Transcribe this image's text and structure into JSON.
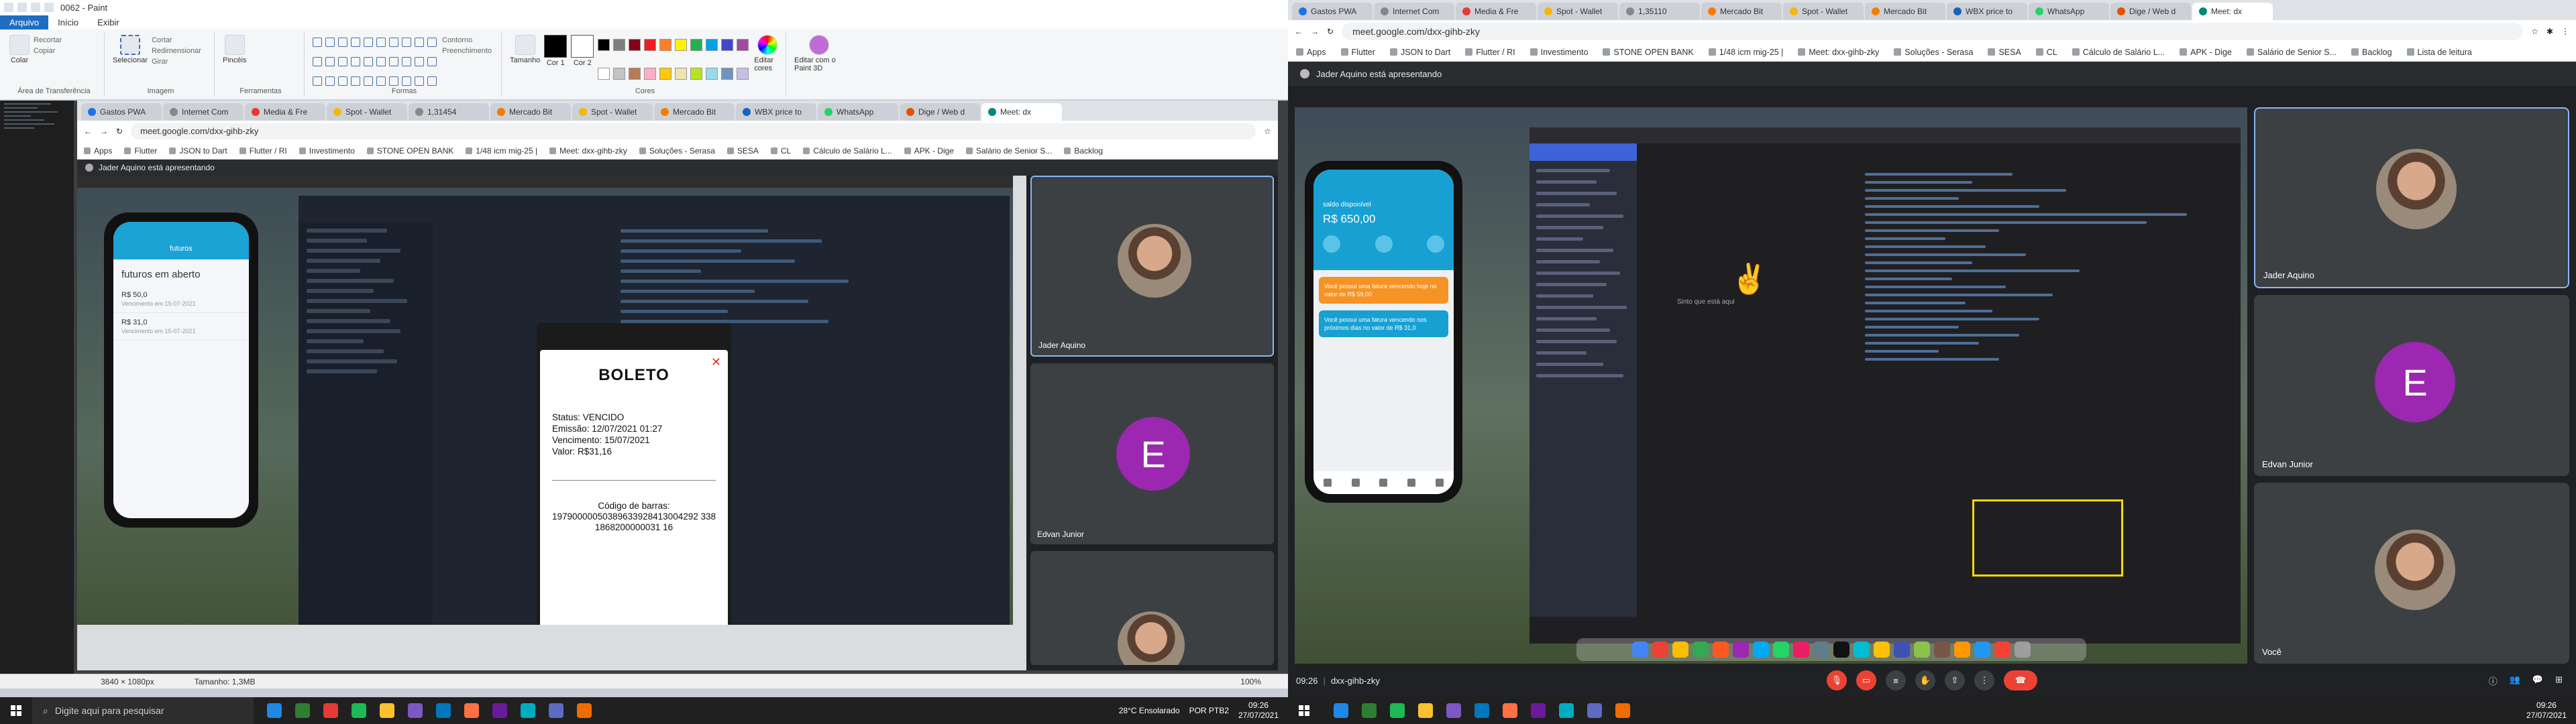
{
  "paint": {
    "title": "0062 - Paint",
    "menu": [
      "Arquivo",
      "Início",
      "Exibir"
    ],
    "groups": {
      "clipboard": {
        "label": "Área de Transferência",
        "paste": "Colar",
        "cut": "Recortar",
        "copy": "Copiar"
      },
      "image": {
        "label": "Imagem",
        "select": "Selecionar",
        "crop": "Cortar",
        "resize": "Redimensionar",
        "rotate": "Girar"
      },
      "tools": {
        "label": "Ferramentas",
        "brushes": "Pincéis"
      },
      "shapes": {
        "label": "Formas",
        "outline": "Contorno",
        "fill": "Preenchimento"
      },
      "colors": {
        "label": "Cores",
        "size": "Tamanho",
        "color1": "Cor 1",
        "color2": "Cor 2",
        "edit": "Editar cores",
        "paint3d": "Editar com o Paint 3D"
      }
    },
    "status": {
      "dimensions": "3840 × 1080px",
      "size": "Tamanho: 1,3MB",
      "zoom": "100%"
    }
  },
  "palette": [
    "#000000",
    "#7f7f7f",
    "#880015",
    "#ed1c24",
    "#ff7f27",
    "#fff200",
    "#22b14c",
    "#00a2e8",
    "#3f48cc",
    "#a349a4",
    "#ffffff",
    "#c3c3c3",
    "#b97a57",
    "#ffaec9",
    "#ffc90e",
    "#efe4b0",
    "#b5e61d",
    "#99d9ea",
    "#7092be",
    "#c8bfe7"
  ],
  "left_browser": {
    "tabs": [
      "Gastos PWA",
      "Internet Com",
      "Media & Fre",
      "Spot - Wallet",
      "1,31454 ",
      "Mercado Bit",
      "Spot - Wallet",
      "Mercado Bit",
      "WBX price to",
      "WhatsApp",
      "Dige / Web d",
      "Meet: dx"
    ],
    "url": "meet.google.com/dxx-gihb-zky",
    "bookmarks": [
      "Apps",
      "Flutter",
      "JSON to Dart",
      "Flutter / RI",
      "Investimento",
      "STONE OPEN BANK",
      "1/48 icm mig-25 |",
      "Meet: dxx-gihb-zky",
      "Soluções - Serasa",
      "SESA",
      "CL",
      "Cálculo de Salário L...",
      "APK - Dige",
      "Salário de Senior S...",
      "Backlog"
    ],
    "presenting": "Jader Aquino está apresentando",
    "phone": {
      "header": "futuros",
      "title": "futuros em aberto",
      "items": [
        {
          "value": "R$ 50,0",
          "sub": "Vencimento em 15-07-2021"
        },
        {
          "value": "R$ 31,0",
          "sub": "Vencimento em 15-07-2021"
        }
      ]
    },
    "boleto": {
      "title": "BOLETO",
      "status": "Status: VENCIDO",
      "emissao": "Emissão: 12/07/2021   01:27",
      "vencimento": "Vencimento: 15/07/2021",
      "valor": "Valor: R$31,16",
      "barcode_label": "Código de barras:",
      "barcode": "19790000050389633928413004292 3381868200000031 16"
    },
    "participants": [
      "Jader Aquino",
      "Edvan Junior"
    ],
    "participant_letter": "E"
  },
  "left_taskbar": {
    "search": "Digite aqui para pesquisar",
    "weather": "28°C  Ensolarado",
    "lang": "POR PTB2",
    "time": "09:26",
    "date": "27/07/2021"
  },
  "right_browser": {
    "tabs": [
      "Gastos PWA",
      "Internet Com",
      "Media & Fre",
      "Spot - Wallet",
      "1,35110 ",
      "Mercado Bit",
      "Spot - Wallet",
      "Mercado Bit",
      "WBX price to",
      "WhatsApp",
      "Dige / Web d",
      "Meet: dx"
    ],
    "url": "meet.google.com/dxx-gihb-zky",
    "bookmarks": [
      "Apps",
      "Flutter",
      "JSON to Dart",
      "Flutter / RI",
      "Investimento",
      "STONE OPEN BANK",
      "1/48 icm mig-25 |",
      "Meet: dxx-gihb-zky",
      "Soluções - Serasa",
      "SESA",
      "CL",
      "Cálculo de Salário L...",
      "APK - Dige",
      "Salário de Senior S...",
      "Backlog",
      "Lista de leitura"
    ],
    "presenting": "Jader Aquino está apresentando",
    "phone": {
      "balance_label": "saldo disponível",
      "balance": "R$ 650,00",
      "alert1": "Você possui uma fatura vencendo hoje no valor de R$ 59,00",
      "alert2": "Você possui uma fatura vencendo nos próximos dias no valor de R$ 31,0"
    },
    "raise_text": "Sinto que está aqui",
    "participants": [
      "Jader Aquino",
      "Edvan Junior",
      "Você"
    ],
    "participant_letter": "E",
    "meeting": {
      "time": "09:26",
      "separator": "|",
      "code": "dxx-gihb-zky"
    },
    "taskbar": {
      "time": "09:26",
      "date": "27/07/2021"
    }
  }
}
